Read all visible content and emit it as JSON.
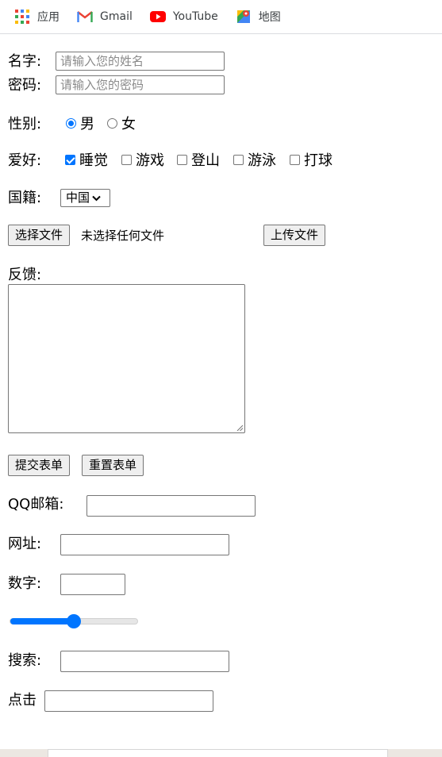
{
  "bookmarks": [
    {
      "label": "应用",
      "icon": "apps-grid-icon"
    },
    {
      "label": "Gmail",
      "icon": "gmail-icon"
    },
    {
      "label": "YouTube",
      "icon": "youtube-icon"
    },
    {
      "label": "地图",
      "icon": "maps-icon"
    }
  ],
  "form": {
    "name_label": "名字:",
    "name_placeholder": "请输入您的姓名",
    "password_label": "密码:",
    "password_placeholder": "请输入您的密码",
    "gender_label": "性别:",
    "gender_options": [
      {
        "label": "男",
        "selected": true
      },
      {
        "label": "女",
        "selected": false
      }
    ],
    "hobby_label": "爱好:",
    "hobbies": [
      {
        "label": "睡觉",
        "checked": true
      },
      {
        "label": "游戏",
        "checked": false
      },
      {
        "label": "登山",
        "checked": false
      },
      {
        "label": "游泳",
        "checked": false
      },
      {
        "label": "打球",
        "checked": false
      }
    ],
    "nationality_label": "国籍:",
    "nationality_value": "中国",
    "file_button": "选择文件",
    "file_status": "未选择任何文件",
    "upload_button": "上传文件",
    "feedback_label": "反馈:",
    "submit_button": "提交表单",
    "reset_button": "重置表单",
    "email_label": "QQ邮箱:",
    "url_label": "网址:",
    "number_label": "数字:",
    "range_value_percent": 50,
    "search_label": "搜索:",
    "click_label": "点击"
  },
  "colors": {
    "accent": "#0075ff",
    "border": "#767676",
    "button_bg": "#efefef",
    "bottom_bar": "#ece7e2"
  }
}
